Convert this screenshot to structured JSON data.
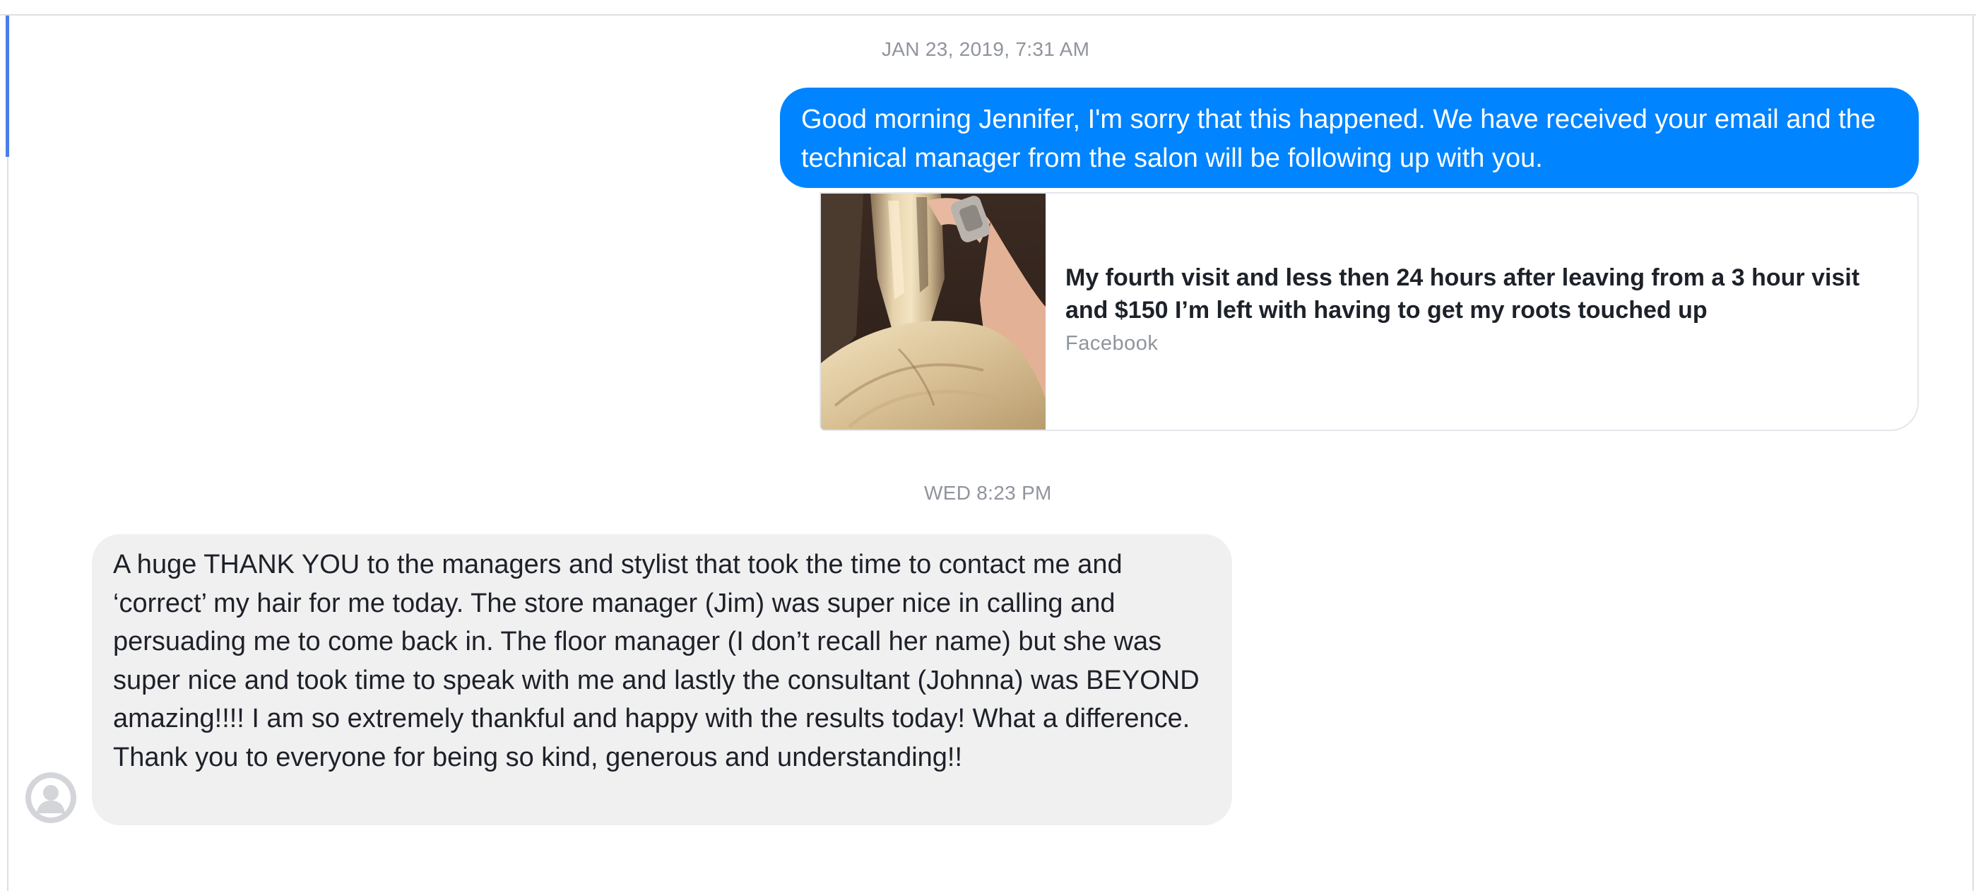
{
  "conversation": {
    "timestamps": [
      "JAN 23, 2019, 7:31 AM",
      "WED 8:23 PM"
    ],
    "outgoing_message": {
      "text": "Good morning Jennifer, I'm sorry that this happened. We have received your email and the technical manager from the salon will be following up with you."
    },
    "link_preview": {
      "title": "My fourth visit and less then 24 hours after leaving from a 3 hour visit and $150 I’m left with having to get my roots touched up",
      "source": "Facebook"
    },
    "incoming_message": {
      "text": "A huge THANK YOU to the managers and stylist that took the time to contact me and ‘correct’ my hair for me today. The store manager (Jim) was super nice in calling and persuading me to come back in. The floor manager (I don’t recall her name) but she was super nice and took time to speak with me and lastly the consultant (Johnna) was BEYOND amazing!!!! I am so extremely thankful and happy with the results today! What a difference. Thank you to everyone for being so kind, generous and understanding!!"
    }
  },
  "colors": {
    "outgoing_bubble": "#0084ff",
    "incoming_bubble": "#f1f0f0",
    "timestamp_text": "#90949c",
    "accent_bar": "#4a7de8"
  },
  "icons": {
    "avatar": "default-profile-silhouette-icon"
  }
}
